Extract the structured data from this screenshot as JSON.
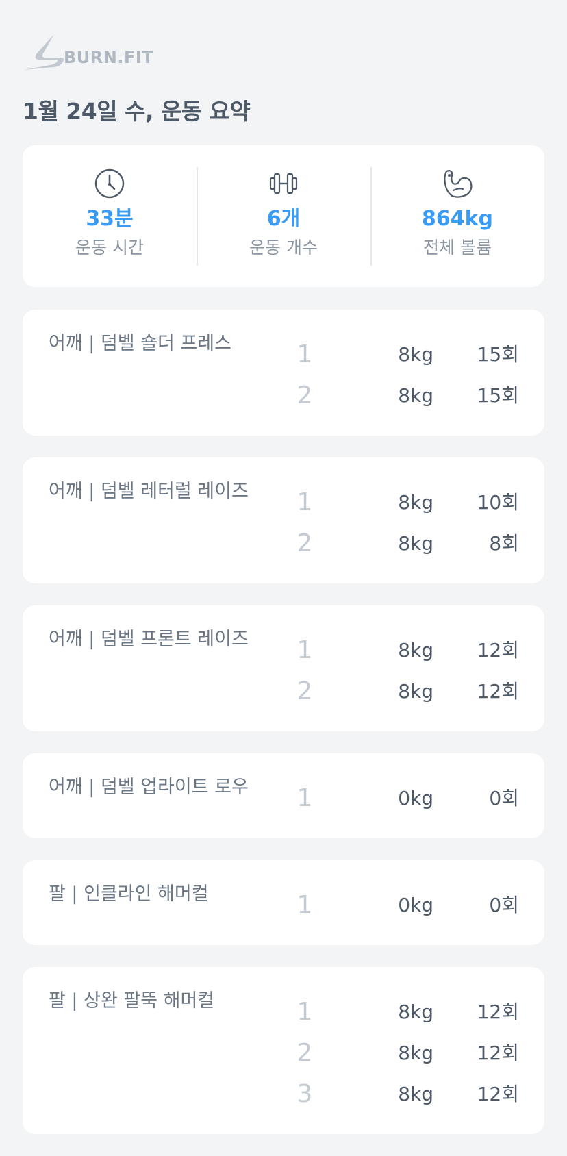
{
  "brand": {
    "name": "BURN.FIT",
    "logo_icon": "burnfit-logo-icon"
  },
  "header": {
    "title": "1월 24일 수, 운동 요약"
  },
  "summary": {
    "stats": [
      {
        "icon": "clock-icon",
        "value": "33분",
        "label": "운동 시간"
      },
      {
        "icon": "dumbbell-icon",
        "value": "6개",
        "label": "운동 개수"
      },
      {
        "icon": "bicep-icon",
        "value": "864kg",
        "label": "전체 볼륨"
      }
    ]
  },
  "exercises": [
    {
      "name": "어깨 | 덤벨 숄더 프레스",
      "sets": [
        {
          "num": "1",
          "weight": "8kg",
          "reps": "15회"
        },
        {
          "num": "2",
          "weight": "8kg",
          "reps": "15회"
        }
      ]
    },
    {
      "name": "어깨 | 덤벨 레터럴 레이즈",
      "sets": [
        {
          "num": "1",
          "weight": "8kg",
          "reps": "10회"
        },
        {
          "num": "2",
          "weight": "8kg",
          "reps": "8회"
        }
      ]
    },
    {
      "name": "어깨 | 덤벨 프론트 레이즈",
      "sets": [
        {
          "num": "1",
          "weight": "8kg",
          "reps": "12회"
        },
        {
          "num": "2",
          "weight": "8kg",
          "reps": "12회"
        }
      ]
    },
    {
      "name": "어깨 | 덤벨 업라이트 로우",
      "sets": [
        {
          "num": "1",
          "weight": "0kg",
          "reps": "0회"
        }
      ]
    },
    {
      "name": "팔 | 인클라인 해머컬",
      "sets": [
        {
          "num": "1",
          "weight": "0kg",
          "reps": "0회"
        }
      ]
    },
    {
      "name": "팔 | 상완 팔뚝 해머컬",
      "sets": [
        {
          "num": "1",
          "weight": "8kg",
          "reps": "12회"
        },
        {
          "num": "2",
          "weight": "8kg",
          "reps": "12회"
        },
        {
          "num": "3",
          "weight": "8kg",
          "reps": "12회"
        }
      ]
    }
  ],
  "colors": {
    "background": "#f2f4f6",
    "card": "#ffffff",
    "accent": "#3a9bf4",
    "muted": "#8b95a1"
  }
}
